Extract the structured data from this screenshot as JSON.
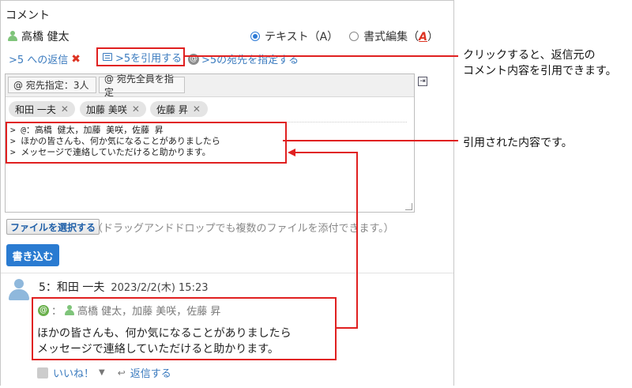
{
  "section_title": "コメント",
  "author": {
    "name": "高橋 健太"
  },
  "format_options": {
    "text_label": "テキスト（A）",
    "rich_label": "書式編集（",
    "rich_icon": "A",
    "rich_close": "）",
    "selected": "text"
  },
  "reply": {
    "label": ">5 への返信",
    "quote_button": ">5を引用する",
    "address_link": ">5の宛先を指定する"
  },
  "editor": {
    "toolbar": {
      "recipients_label": "@ 宛先指定：3人",
      "all_recipients_label": "@ 宛先全員を指定"
    },
    "recipients": [
      "和田 一夫",
      "加藤 美咲",
      "佐藤 昇"
    ],
    "content": "> @：高橋 健太，加藤 美咲，佐藤 昇\n> ほかの皆さんも、何か気になることがありましたら\n> メッセージで連絡していただけると助かります。"
  },
  "file": {
    "button": "ファイルを選択する",
    "hint": "（ドラッグアンドドロップでも複数のファイルを添付できます。）"
  },
  "submit_label": "書き込む",
  "post": {
    "number_author": "5：和田 一夫",
    "date": "2023/2/2(木) 15:23",
    "mention_prefix": "：",
    "mentions": "高橋 健太，加藤 美咲，佐藤 昇",
    "body_line1": "ほかの皆さんも、何か気になることがありましたら",
    "body_line2": "メッセージで連絡していただけると助かります。",
    "like_label": "いいね！",
    "reply_label": "返信する"
  },
  "annotations": {
    "quote_note_line1": "クリックすると、返信元の",
    "quote_note_line2": "コメント内容を引用できます。",
    "quoted_note": "引用された内容です。"
  },
  "colors": {
    "highlight": "#e02020",
    "link": "#3b7bbf",
    "primary_button": "#2a7bd1"
  }
}
